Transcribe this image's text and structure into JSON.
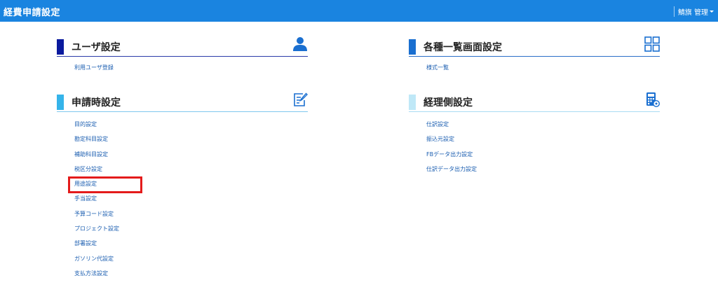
{
  "app": {
    "title": "経費申請設定",
    "user_menu_label": "鯖旗 管理"
  },
  "sections": {
    "user": {
      "title": "ユーザ設定",
      "icon": "user-icon",
      "bar_color": "#0a1a9e",
      "links": [
        "利用ユーザ登録"
      ]
    },
    "list_screen": {
      "title": "各種一覧画面設定",
      "icon": "grid-icon",
      "bar_color": "#1a6fd0",
      "links": [
        "様式一覧"
      ]
    },
    "application": {
      "title": "申請時設定",
      "icon": "edit-document-icon",
      "bar_color": "#35b4ea",
      "links": [
        "目的設定",
        "勘定科目設定",
        "補助科目設定",
        "税区分設定",
        "用途設定",
        "手当設定",
        "予算コード設定",
        "プロジェクト設定",
        "部署設定",
        "ガソリン代設定",
        "支払方法設定"
      ]
    },
    "accounting": {
      "title": "経理側設定",
      "icon": "calculator-icon",
      "bar_color": "#bfe8f7",
      "links": [
        "仕訳設定",
        "振込元設定",
        "FBデータ出力設定",
        "仕訳データ出力設定"
      ]
    }
  },
  "highlight": {
    "target": "用途設定",
    "color": "#e41b1b"
  }
}
